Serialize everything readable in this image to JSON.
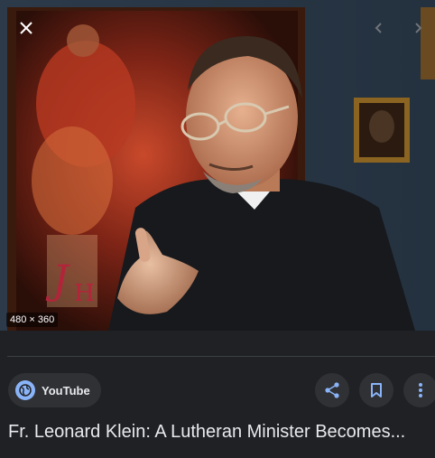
{
  "viewer": {
    "image_dimensions": "480 × 360",
    "close_icon": "close-icon",
    "prev_icon": "chevron-left-icon",
    "next_icon": "chevron-right-icon"
  },
  "source": {
    "name": "YouTube",
    "icon": "globe-icon"
  },
  "actions": {
    "share_icon": "share-icon",
    "save_icon": "bookmark-icon",
    "more_icon": "more-vertical-icon"
  },
  "title": "Fr. Leonard Klein: A Lutheran Minister Becomes...",
  "colors": {
    "background": "#202124",
    "chip": "#303134",
    "text": "#e8eaed",
    "accent": "#8ab4f8"
  }
}
